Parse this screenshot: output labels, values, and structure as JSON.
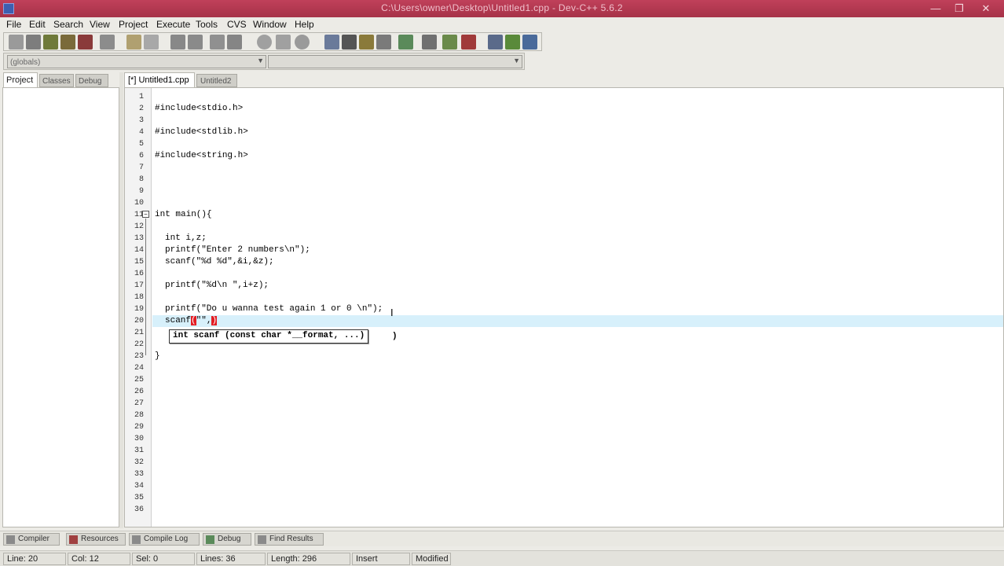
{
  "window": {
    "title": "C:\\Users\\owner\\Desktop\\Untitled1.cpp - Dev-C++ 5.6.2",
    "min": "—",
    "max": "❐",
    "close": "✕"
  },
  "menu": [
    "File",
    "Edit",
    "Search",
    "View",
    "Project",
    "Execute",
    "Tools",
    "CVS",
    "Window",
    "Help"
  ],
  "toolbar": {
    "icons": [
      "new-file",
      "open",
      "save",
      "save-all",
      "close",
      "print",
      "undo",
      "redo",
      "find",
      "replace",
      "find-next",
      "goto",
      "indent",
      "unindent",
      "toggle-comment",
      "bookmark",
      "compile",
      "run",
      "compile-run",
      "rebuild",
      "check-syntax",
      "debug",
      "profile",
      "delete-profile",
      "new-project",
      "options",
      "about"
    ]
  },
  "combos": {
    "first": "(globals)",
    "second": ""
  },
  "left_panel": {
    "tabs": [
      "Project",
      "Classes",
      "Debug"
    ],
    "active": "Project"
  },
  "editor": {
    "tabs": [
      "[*] Untitled1.cpp",
      "Untitled2"
    ],
    "line_numbers": [
      "1",
      "2",
      "3",
      "4",
      "5",
      "6",
      "7",
      "8",
      "9",
      "10",
      "11",
      "12",
      "13",
      "14",
      "15",
      "16",
      "17",
      "18",
      "19",
      "20",
      "21",
      "22",
      "23",
      "24",
      "25",
      "26",
      "27",
      "28",
      "29",
      "30",
      "31",
      "32",
      "33",
      "34",
      "35",
      "36"
    ],
    "code": {
      "l2": "#include<stdio.h>",
      "l4": "#include<stdlib.h>",
      "l6": "#include<string.h>",
      "l11": "int main(){",
      "l13": "int i,z;",
      "l14": "printf(\"Enter 2 numbers\\n\");",
      "l15": "scanf(\"%d %d\",&i,&z);",
      "l17": "printf(\"%d\\n \",i+z);",
      "l19": "printf(\"Do u wanna test again 1 or 0 \\n\");",
      "l20_pre": "scanf",
      "l20_paren": "(",
      "l20_mid": "\"\",",
      "l20_close": ")",
      "l22": "}"
    },
    "tooltip": "int scanf (const char *__format, ...)",
    "tooltip_tail": ")",
    "ibeam": "I"
  },
  "bottom_tabs": [
    "Compiler",
    "Resources",
    "Compile Log",
    "Debug",
    "Find Results"
  ],
  "status": {
    "line_label": "Line:",
    "line": "20",
    "col_label": "Col:",
    "col": "12",
    "sel_label": "Sel:",
    "sel": "0",
    "lines_label": "Lines:",
    "lines": "36",
    "length_label": "Length:",
    "length": "296",
    "mode": "Insert",
    "modified": "Modified"
  }
}
